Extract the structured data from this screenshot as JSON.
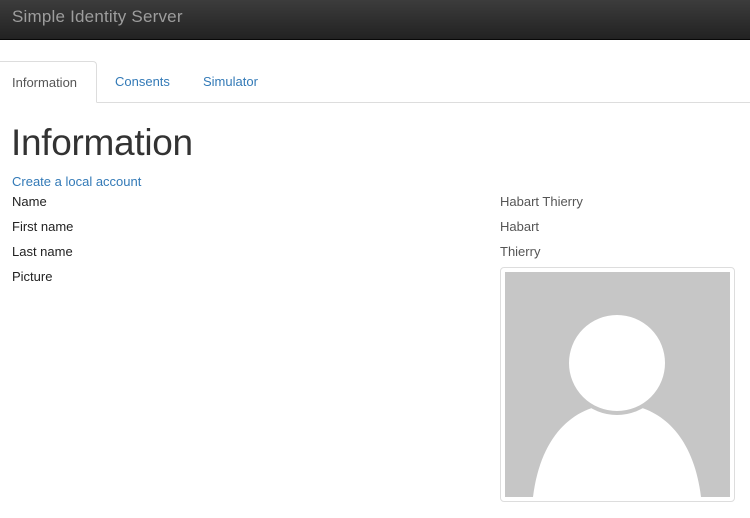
{
  "app": {
    "brand": "Simple Identity Server"
  },
  "tabs": [
    {
      "label": "Information",
      "active": true
    },
    {
      "label": "Consents",
      "active": false
    },
    {
      "label": "Simulator",
      "active": false
    }
  ],
  "page": {
    "title": "Information",
    "create_account_link": "Create a local account"
  },
  "fields": [
    {
      "label": "Name",
      "value": "Habart Thierry"
    },
    {
      "label": "First name",
      "value": "Habart"
    },
    {
      "label": "Last name",
      "value": "Thierry"
    },
    {
      "label": "Picture",
      "value": ""
    }
  ],
  "picture": {
    "icon": "default-avatar-icon"
  },
  "colors": {
    "navbar": "#222222",
    "brand_text": "#9d9d9d",
    "link": "#337ab7",
    "avatar_bg": "#c6c6c6",
    "avatar_fg": "#ffffff"
  }
}
